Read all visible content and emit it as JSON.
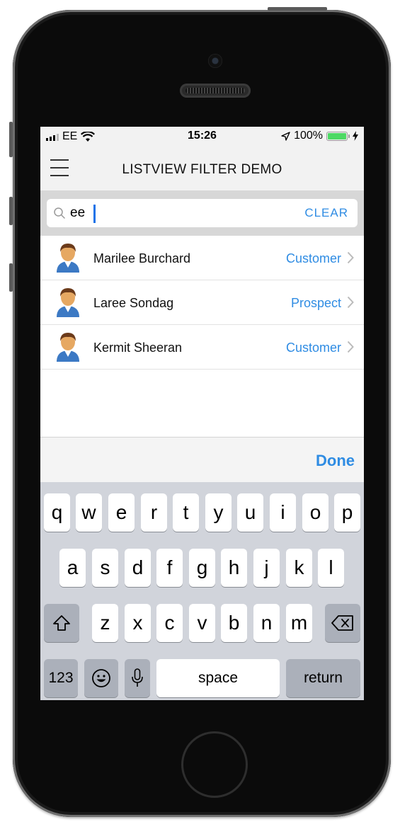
{
  "status_bar": {
    "carrier": "EE",
    "time": "15:26",
    "battery": "100%",
    "icons": [
      "signal-icon",
      "wifi-icon",
      "location-icon",
      "battery-icon",
      "charging-icon"
    ]
  },
  "navbar": {
    "title": "LISTVIEW FILTER DEMO",
    "menu_icon": "hamburger-icon"
  },
  "search": {
    "value": "ee",
    "clear_label": "CLEAR",
    "icon": "search-icon"
  },
  "contacts": [
    {
      "name": "Marilee Burchard",
      "status": "Customer"
    },
    {
      "name": "Laree Sondag",
      "status": "Prospect"
    },
    {
      "name": "Kermit Sheeran",
      "status": "Customer"
    }
  ],
  "accessory": {
    "done_label": "Done"
  },
  "keyboard": {
    "row1": [
      "q",
      "w",
      "e",
      "r",
      "t",
      "y",
      "u",
      "i",
      "o",
      "p"
    ],
    "row2": [
      "a",
      "s",
      "d",
      "f",
      "g",
      "h",
      "j",
      "k",
      "l"
    ],
    "row3": [
      "z",
      "x",
      "c",
      "v",
      "b",
      "n",
      "m"
    ],
    "numbers_label": "123",
    "space_label": "space",
    "return_label": "return"
  },
  "colors": {
    "accent": "#2f8ce3",
    "battery": "#4cd964",
    "keyboard_bg": "#d1d4db"
  }
}
